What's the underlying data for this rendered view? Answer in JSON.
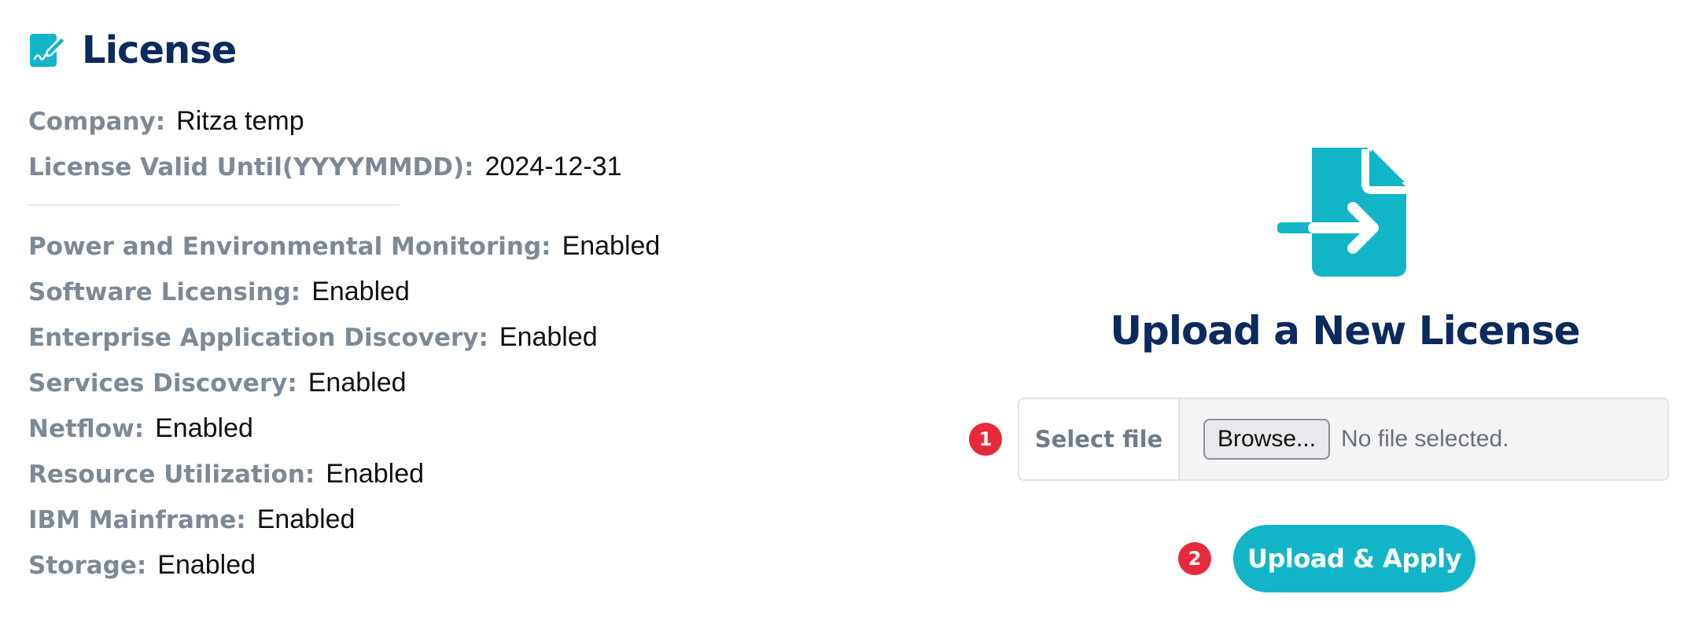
{
  "header": {
    "title": "License",
    "icon": "license-signature-icon"
  },
  "license_info": {
    "company": {
      "label": "Company:",
      "value": "Ritza temp"
    },
    "valid_until": {
      "label": "License Valid Until(YYYYMMDD):",
      "value": "2024-12-31"
    }
  },
  "features": [
    {
      "label": "Power and Environmental Monitoring:",
      "value": "Enabled"
    },
    {
      "label": "Software Licensing:",
      "value": "Enabled"
    },
    {
      "label": "Enterprise Application Discovery:",
      "value": "Enabled"
    },
    {
      "label": "Services Discovery:",
      "value": "Enabled"
    },
    {
      "label": "Netflow:",
      "value": "Enabled"
    },
    {
      "label": "Resource Utilization:",
      "value": "Enabled"
    },
    {
      "label": "IBM Mainframe:",
      "value": "Enabled"
    },
    {
      "label": "Storage:",
      "value": "Enabled"
    }
  ],
  "upload": {
    "icon": "file-import-icon",
    "title": "Upload a New License",
    "step1_badge": "1",
    "step2_badge": "2",
    "select_file_label": "Select file",
    "browse_label": "Browse...",
    "file_status": "No file selected.",
    "apply_label": "Upload & Apply"
  },
  "colors": {
    "accent": "#12b5c8",
    "title": "#0b2a5e",
    "label": "#7d8a96",
    "badge": "#e8293b"
  }
}
